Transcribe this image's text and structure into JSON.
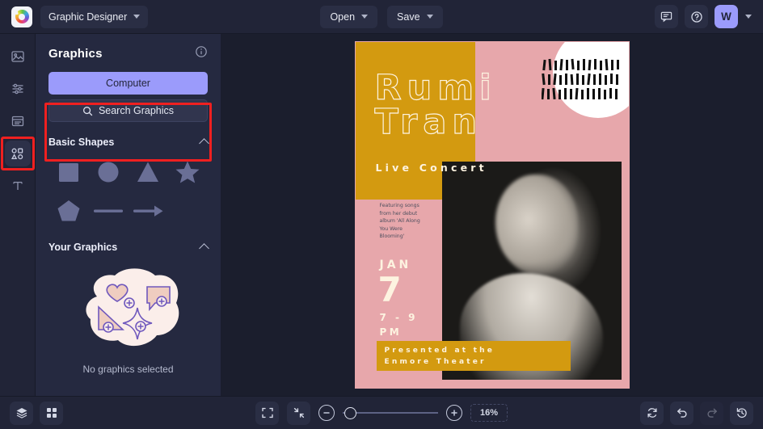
{
  "topbar": {
    "logo_icon": "color-wheel-logo-icon",
    "document_name": "Graphic Designer",
    "open_label": "Open",
    "save_label": "Save",
    "chat_icon": "chat-bubble-icon",
    "help_icon": "help-circle-icon",
    "avatar_initial": "W"
  },
  "rail": {
    "items": [
      {
        "icon": "image-icon",
        "name": "sidebar-item-images"
      },
      {
        "icon": "sliders-icon",
        "name": "sidebar-item-adjust"
      },
      {
        "icon": "pages-icon",
        "name": "sidebar-item-pages"
      },
      {
        "icon": "shapes-icon",
        "name": "sidebar-item-graphics"
      },
      {
        "icon": "text-icon",
        "name": "sidebar-item-text"
      }
    ]
  },
  "panel": {
    "title": "Graphics",
    "info_icon": "info-circle-icon",
    "computer_label": "Computer",
    "search_label": "Search Graphics",
    "search_icon": "search-icon",
    "basic_shapes": {
      "title": "Basic Shapes",
      "collapse_icon": "chevron-up-icon",
      "shapes": [
        {
          "name": "shape-square",
          "label": "square"
        },
        {
          "name": "shape-circle",
          "label": "circle"
        },
        {
          "name": "shape-triangle",
          "label": "triangle"
        },
        {
          "name": "shape-star",
          "label": "star"
        },
        {
          "name": "shape-pentagon",
          "label": "pentagon"
        },
        {
          "name": "shape-line",
          "label": "line"
        },
        {
          "name": "shape-arrow",
          "label": "arrow"
        }
      ]
    },
    "your_graphics": {
      "title": "Your Graphics",
      "collapse_icon": "chevron-up-icon",
      "empty_illustration": "graphics-blob-illustration",
      "empty_text": "No graphics selected"
    }
  },
  "canvas": {
    "poster": {
      "title": "Rumi\nTran",
      "subtitle": "Live Concert",
      "featuring": "Featuring songs from her debut album 'All Along You Were Blooming'",
      "month": "JAN",
      "day": "7",
      "time": "7 - 9\nPM",
      "banner": "Presented at the\nEnmore Theater",
      "colors": {
        "gold": "#d39a10",
        "pink": "#e7a7ab",
        "cream": "#fdf3e0",
        "white": "#ffffff"
      }
    }
  },
  "bottombar": {
    "layers_icon": "layers-icon",
    "grid_icon": "grid-icon",
    "fit_icon": "fit-to-screen-icon",
    "shrink_icon": "shrink-icon",
    "zoom_out_icon": "zoom-out-icon",
    "zoom_in_icon": "zoom-in-icon",
    "zoom_level": "16%",
    "reset_icon": "reset-icon",
    "undo_icon": "undo-icon",
    "redo_icon": "redo-icon",
    "history_icon": "history-icon"
  },
  "theme": {
    "accent": "#9b9bfb",
    "highlight": "#ef2020",
    "panel_bg": "#252940",
    "chrome_bg": "#212437"
  }
}
